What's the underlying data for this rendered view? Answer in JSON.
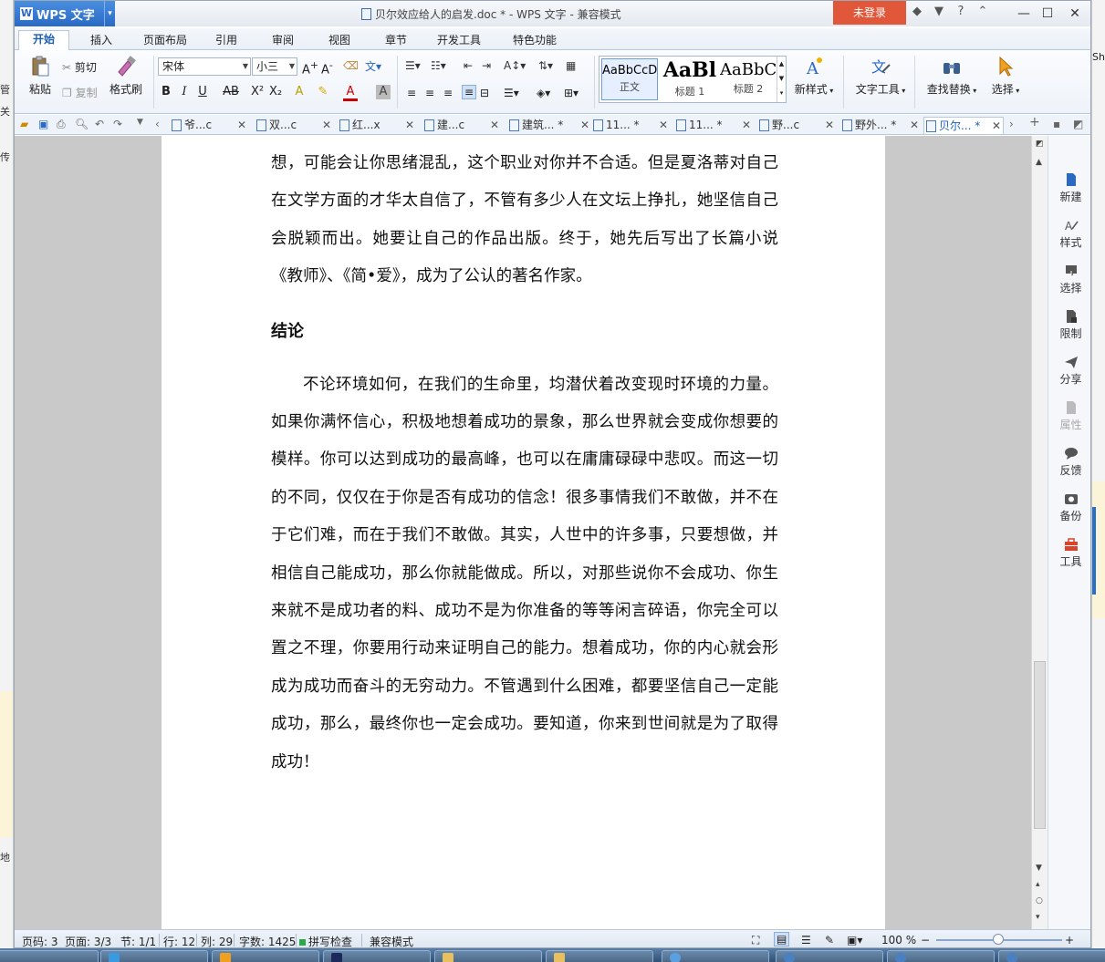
{
  "titlebar": {
    "app_name": "WPS 文字",
    "app_logo": "W",
    "app_dropdown": "▾",
    "document_title": "贝尔效应给人的启发.doc * - WPS 文字 - 兼容模式",
    "login": "未登录",
    "help": "?",
    "icons": [
      "skin-icon",
      "shirt-icon",
      "help-icon",
      "ribbon-collapse-icon"
    ],
    "controls": {
      "minimize": "—",
      "maximize": "☐",
      "close": "✕"
    }
  },
  "ribbon_tabs": [
    "开始",
    "插入",
    "页面布局",
    "引用",
    "审阅",
    "视图",
    "章节",
    "开发工具",
    "特色功能"
  ],
  "ribbon": {
    "paste": "粘贴",
    "cut": "剪切",
    "copy": "复制",
    "format_painter": "格式刷",
    "font_name": "宋体",
    "font_size": "小三",
    "styles": [
      {
        "sample": "AaBbCcD",
        "label": "正文"
      },
      {
        "sample": "AaBl",
        "label": "标题 1"
      },
      {
        "sample": "AaBbC",
        "label": "标题 2"
      }
    ],
    "new_style": "新样式",
    "text_tools": "文字工具",
    "find_replace": "查找替换",
    "select": "选择",
    "accent_color": "#1d5fb5"
  },
  "doc_tabs": [
    {
      "label": "爷...c",
      "active": false
    },
    {
      "label": "双...c",
      "active": false
    },
    {
      "label": "红...x",
      "active": false
    },
    {
      "label": "建...c",
      "active": false
    },
    {
      "label": "建筑... *",
      "active": false
    },
    {
      "label": "11... *",
      "active": false
    },
    {
      "label": "11... *",
      "active": false
    },
    {
      "label": "野...c",
      "active": false
    },
    {
      "label": "野外... *",
      "active": false
    },
    {
      "label": "贝尔... *",
      "active": true
    }
  ],
  "document": {
    "para1": "想，可能会让你思绪混乱，这个职业对你并不合适。但是夏洛蒂对自己在文学方面的才华太自信了，不管有多少人在文坛上挣扎，她坚信自己会脱颖而出。她要让自己的作品出版。终于，她先后写出了长篇小说《教师》、《简•爱》，成为了公认的著名作家。",
    "heading": "结论",
    "para2": "不论环境如何，在我们的生命里，均潜伏着改变现时环境的力量。如果你满怀信心，积极地想着成功的景象，那么世界就会变成你想要的模样。你可以达到成功的最高峰，也可以在庸庸碌碌中悲叹。而这一切的不同，仅仅在于你是否有成功的信念！很多事情我们不敢做，并不在于它们难，而在于我们不敢做。其实，人世中的许多事，只要想做，并相信自己能成功，那么你就能做成。所以，对那些说你不会成功、你生来就不是成功者的料、成功不是为你准备的等等闲言碎语，你完全可以置之不理，你要用行动来证明自己的能力。想着成功，你的内心就会形成为成功而奋斗的无穷动力。不管遇到什么困难，都要坚信自己一定能成功，那么，最终你也一定会成功。要知道，你来到世间就是为了取得成功！"
  },
  "sidepane": [
    {
      "label": "新建",
      "icon": "new-doc-icon",
      "dim": false
    },
    {
      "label": "样式",
      "icon": "style-icon",
      "dim": false
    },
    {
      "label": "选择",
      "icon": "select-icon",
      "dim": false
    },
    {
      "label": "限制",
      "icon": "restrict-icon",
      "dim": false
    },
    {
      "label": "分享",
      "icon": "share-icon",
      "dim": false
    },
    {
      "label": "属性",
      "icon": "properties-icon",
      "dim": true
    },
    {
      "label": "反馈",
      "icon": "feedback-icon",
      "dim": false
    },
    {
      "label": "备份",
      "icon": "backup-icon",
      "dim": false
    },
    {
      "label": "工具",
      "icon": "toolbox-icon",
      "dim": false
    }
  ],
  "statusbar": {
    "page_code": "页码: 3",
    "pages": "页面: 3/3",
    "section": "节: 1/1",
    "row": "行: 12",
    "col": "列: 29",
    "word_count": "字数: 1425",
    "spell_check": "拼写检查",
    "compat_mode": "兼容模式",
    "zoom": "100 %",
    "zoom_minus": "−",
    "zoom_plus": "+"
  },
  "background_fragments": {
    "left": [
      "管",
      "关",
      "传",
      "地"
    ],
    "right": [
      "Sh"
    ]
  }
}
